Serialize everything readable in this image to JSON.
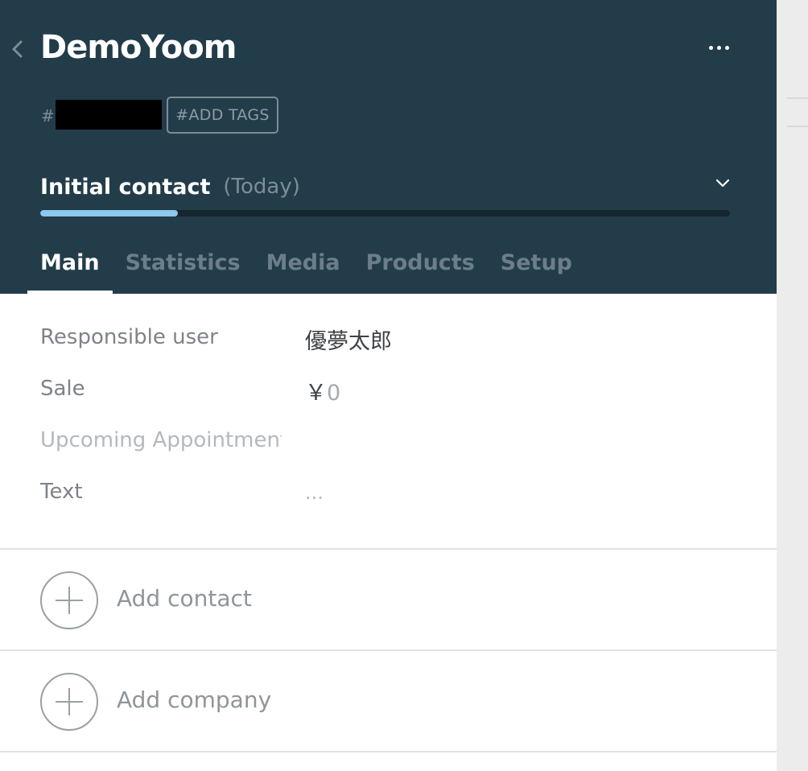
{
  "header": {
    "title": "DemoYoom",
    "tag_prefix": "#",
    "add_tags_label": "#ADD TAGS"
  },
  "stage": {
    "name": "Initial contact",
    "date": "(Today)",
    "progress": 0.2
  },
  "tabs": [
    {
      "label": "Main",
      "active": true
    },
    {
      "label": "Statistics",
      "active": false
    },
    {
      "label": "Media",
      "active": false
    },
    {
      "label": "Products",
      "active": false
    },
    {
      "label": "Setup",
      "active": false
    }
  ],
  "fields": {
    "responsible_user": {
      "label": "Responsible user",
      "value": "優夢太郎"
    },
    "sale": {
      "label": "Sale",
      "currency": "￥",
      "value": "0"
    },
    "upcoming": {
      "label": "Upcoming Appointment"
    },
    "text": {
      "label": "Text",
      "placeholder": "..."
    }
  },
  "actions": {
    "add_contact": "Add contact",
    "add_company": "Add company"
  },
  "colors": {
    "header_bg": "#233c4a",
    "progress_fill": "#8ec7f0"
  }
}
